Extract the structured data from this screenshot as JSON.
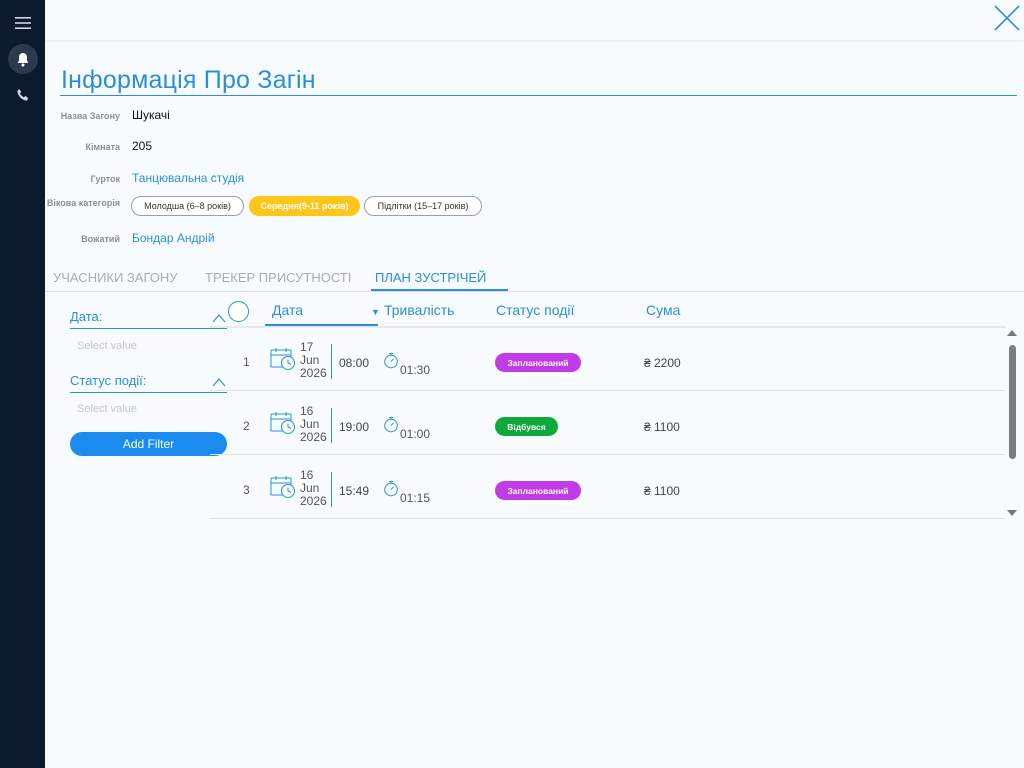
{
  "nav": {
    "icons": [
      "menu-icon",
      "bell-icon",
      "phone-icon"
    ],
    "close_icon": "close-icon"
  },
  "page": {
    "title": "Інформація Про Загін"
  },
  "details": {
    "name_label": "Назва Загону",
    "name_value": "Шукачі",
    "room_label": "Кімната",
    "room_value": "205",
    "club_label": "Гурток",
    "club_value": "Танцювальна студія",
    "age_label": "Вікова категорія",
    "age_options": [
      {
        "label": "Молодша (6–8 років)",
        "selected": false
      },
      {
        "label": "Середня(9-11 років)",
        "selected": true
      },
      {
        "label": "Підлітки (15–17 років)",
        "selected": false
      }
    ],
    "counselor_label": "Вожатий",
    "counselor_value": "Бондар Андрій"
  },
  "tabs": [
    {
      "label": "УЧАСНИКИ ЗАГОНУ",
      "active": false
    },
    {
      "label": "ТРЕКЕР ПРИСУТНОСТІ",
      "active": false
    },
    {
      "label": "ПЛАН ЗУСТРІЧЕЙ",
      "active": true
    }
  ],
  "filters": {
    "date_label": "Дата:",
    "date_placeholder": "Select value",
    "status_label": "Статус події:",
    "status_placeholder": "Select value",
    "add_button": "Add Filter"
  },
  "table": {
    "columns": [
      "Дата",
      "Тривалість",
      "Статус події",
      "Сума"
    ],
    "sort_indicator": "▼",
    "rows": [
      {
        "num": "1",
        "day": "17",
        "month": "Jun",
        "year": "2026",
        "time": "08:00",
        "duration": "01:30",
        "status": "Запланований",
        "status_color": "#c13be6",
        "amount": "₴ 2200"
      },
      {
        "num": "2",
        "day": "16",
        "month": "Jun",
        "year": "2026",
        "time": "19:00",
        "duration": "01:00",
        "status": "Відбувся",
        "status_color": "#0fa93a",
        "amount": "₴ 1100"
      },
      {
        "num": "3",
        "day": "16",
        "month": "Jun",
        "year": "2026",
        "time": "15:49",
        "duration": "01:15",
        "status": "Запланований",
        "status_color": "#c13be6",
        "amount": "₴ 1100"
      }
    ]
  },
  "colors": {
    "accent": "#2b8fd8",
    "rail": "#0c1a2e",
    "selected_chip": "#ffc61a",
    "button": "#1a8cf0"
  }
}
